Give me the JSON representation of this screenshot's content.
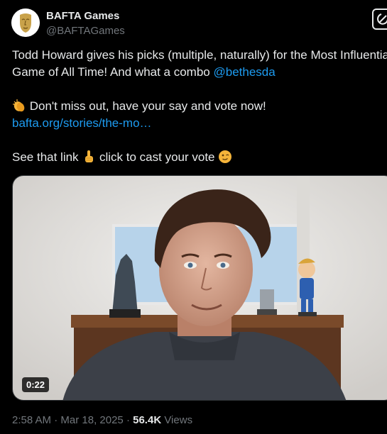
{
  "author": {
    "name": "BAFTA Games",
    "handle": "@BAFTAGames"
  },
  "tweet": {
    "line1": "Todd Howard gives his picks (multiple, naturally) for the Most Influential",
    "line2_prefix": "Game of All Time! And what a combo ",
    "mention": "@bethesda",
    "line3": "Don't miss out, have your say and vote now!",
    "link": "bafta.org/stories/the-mo…",
    "line5_a": "See that link ",
    "line5_b": " click to cast your vote "
  },
  "video": {
    "duration": "0:22"
  },
  "meta": {
    "time": "2:58 AM",
    "date": "Mar 18, 2025",
    "separator": "·",
    "views_count": "56.4K",
    "views_label": "Views"
  },
  "icons": {
    "clap": "clapping-hands-emoji",
    "point": "pointing-up-emoji",
    "wink": "winking-face-emoji",
    "grok": "grok-icon"
  },
  "colors": {
    "link": "#1d9bf0",
    "secondary_text": "#71767b",
    "text": "#e7e9ea",
    "background": "#000000"
  }
}
